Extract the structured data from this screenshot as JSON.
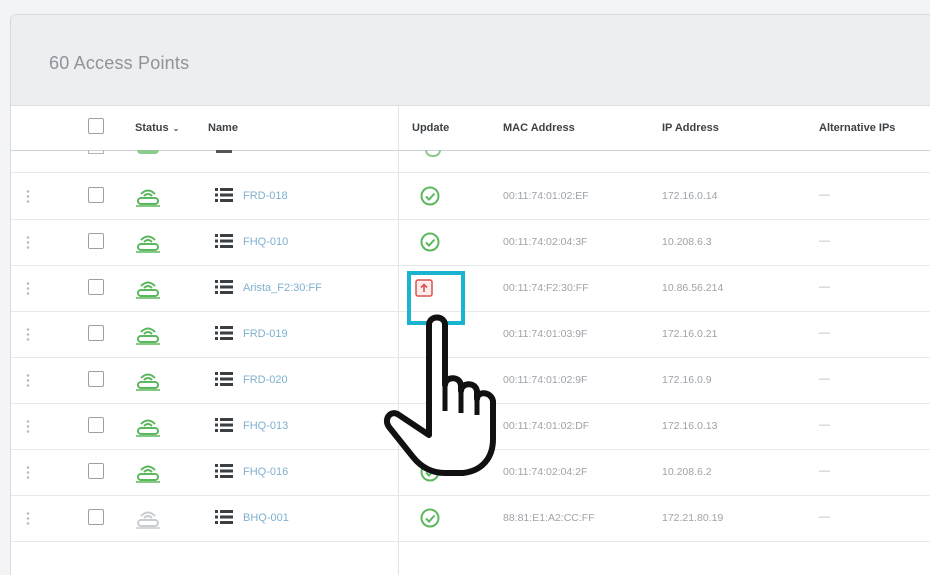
{
  "panel": {
    "title": "60 Access Points"
  },
  "columns": {
    "status": "Status",
    "status_sort": "⌄",
    "name": "Name",
    "update": "Update",
    "mac": "MAC Address",
    "ip": "IP Address",
    "alt_ips": "Alternative IPs"
  },
  "colors": {
    "accent": "#1ab4d0",
    "online_green": "#5bb85d",
    "update_ok": "#5bb85d",
    "update_pending": "#d9534f",
    "link": "#7fb0cf"
  },
  "rows": [
    {
      "name": "FRD-018",
      "status": "online",
      "update": "ok",
      "mac": "00:11:74:01:02:EF",
      "ip": "172.16.0.14",
      "alt": "—"
    },
    {
      "name": "FHQ-010",
      "status": "online",
      "update": "ok",
      "mac": "00:11:74:02:04:3F",
      "ip": "10.208.6.3",
      "alt": "—"
    },
    {
      "name": "Arista_F2:30:FF",
      "status": "online",
      "update": "pending",
      "mac": "00:11:74:F2:30:FF",
      "ip": "10.86.56.214",
      "alt": "—"
    },
    {
      "name": "FRD-019",
      "status": "online",
      "update": "hidden",
      "mac": "00:11:74:01:03:9F",
      "ip": "172.16.0.21",
      "alt": "—"
    },
    {
      "name": "FRD-020",
      "status": "online",
      "update": "hidden",
      "mac": "00:11:74:01:02:9F",
      "ip": "172.16.0.9",
      "alt": "—"
    },
    {
      "name": "FHQ-013",
      "status": "online",
      "update": "hidden",
      "mac": "00:11:74:01:02:DF",
      "ip": "172.16.0.13",
      "alt": "—"
    },
    {
      "name": "FHQ-016",
      "status": "online",
      "update": "ok",
      "mac": "00:11:74:02:04:2F",
      "ip": "10.208.6.2",
      "alt": "—"
    },
    {
      "name": "BHQ-001",
      "status": "offline",
      "update": "ok",
      "mac": "88:81:E1:A2:CC:FF",
      "ip": "172.21.80.19",
      "alt": "—"
    }
  ],
  "icons": {
    "status_online": "access-point-online-icon",
    "status_offline": "access-point-offline-icon",
    "details": "list-icon",
    "update_ok": "check-circle-icon",
    "update_pending": "update-pending-icon",
    "cursor": "hand-pointer-icon"
  }
}
